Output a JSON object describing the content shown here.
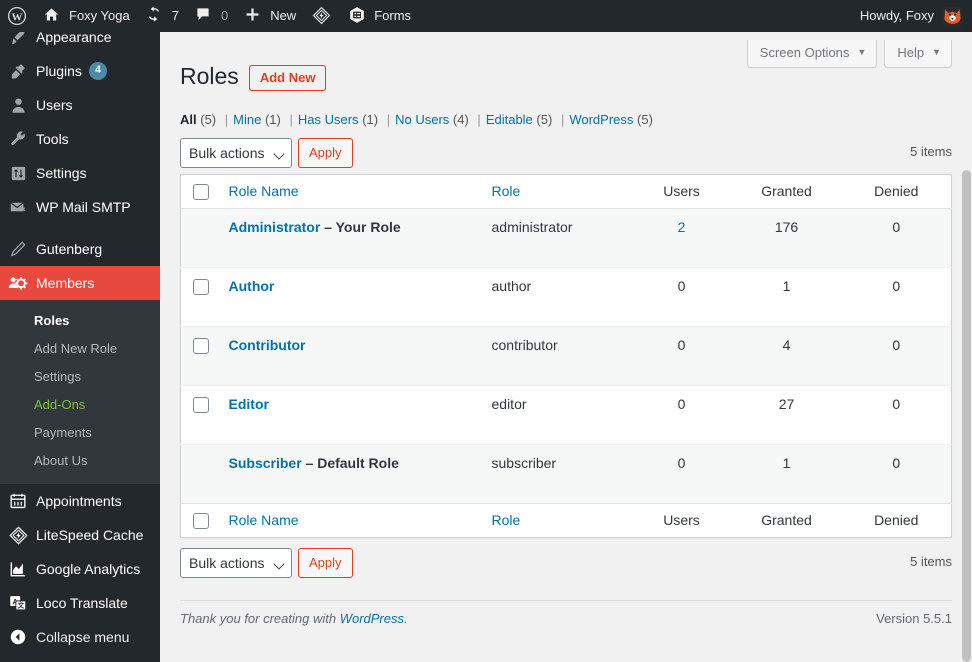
{
  "adminbar": {
    "logo_icon": "wordpress-logo-icon",
    "site": {
      "icon": "home-icon",
      "label": "Foxy Yoga"
    },
    "updates": {
      "icon": "updates-icon",
      "count": "7"
    },
    "comments": {
      "icon": "comment-bubble-icon",
      "count": "0"
    },
    "new": {
      "icon": "plus-icon",
      "label": "New"
    },
    "litespeed": {
      "icon": "litespeed-diamond-icon"
    },
    "forms": {
      "icon": "forms-icon",
      "label": "Forms"
    },
    "howdy": "Howdy, Foxy",
    "avatar_icon": "fox-avatar-icon"
  },
  "sidebar": {
    "items": [
      {
        "label": "Appearance",
        "icon": "appearance-brush-icon",
        "state": "partial"
      },
      {
        "label": "Plugins",
        "icon": "plugins-plug-icon",
        "badge": "4"
      },
      {
        "label": "Users",
        "icon": "users-person-icon"
      },
      {
        "label": "Tools",
        "icon": "tools-wrench-icon"
      },
      {
        "label": "Settings",
        "icon": "settings-sliders-icon"
      },
      {
        "label": "WP Mail SMTP",
        "icon": "email-icon"
      },
      {
        "label": "Gutenberg",
        "icon": "pencil-icon"
      },
      {
        "label": "Members",
        "icon": "members-group-icon",
        "state": "current"
      }
    ],
    "submenu": [
      {
        "label": "Roles",
        "state": "current"
      },
      {
        "label": "Add New Role"
      },
      {
        "label": "Settings"
      },
      {
        "label": "Add-Ons",
        "state": "highlight"
      },
      {
        "label": "Payments"
      },
      {
        "label": "About Us"
      }
    ],
    "lower_items": [
      {
        "label": "Appointments",
        "icon": "calendar-icon"
      },
      {
        "label": "LiteSpeed Cache",
        "icon": "litespeed-diamond-icon"
      },
      {
        "label": "Google Analytics",
        "icon": "analytics-chart-icon"
      },
      {
        "label": "Loco Translate",
        "icon": "translate-icon"
      }
    ],
    "collapse": {
      "label": "Collapse menu",
      "icon": "collapse-arrow-icon"
    }
  },
  "screen_meta": {
    "screen_options": "Screen Options",
    "help": "Help",
    "caret": "▼"
  },
  "page": {
    "title": "Roles",
    "add_new": "Add New"
  },
  "filters": [
    {
      "label": "All",
      "count": "(5)",
      "current": true
    },
    {
      "label": "Mine",
      "count": "(1)"
    },
    {
      "label": "Has Users",
      "count": "(1)"
    },
    {
      "label": "No Users",
      "count": "(4)"
    },
    {
      "label": "Editable",
      "count": "(5)"
    },
    {
      "label": "WordPress",
      "count": "(5)"
    }
  ],
  "tablenav": {
    "bulk_actions": "Bulk actions",
    "apply": "Apply",
    "items_count": "5 items"
  },
  "table": {
    "columns": {
      "name": "Role Name",
      "role": "Role",
      "users": "Users",
      "granted": "Granted",
      "denied": "Denied"
    },
    "rows": [
      {
        "name": "Administrator",
        "note": "– Your Role",
        "role": "administrator",
        "users": "2",
        "users_link": true,
        "granted": "176",
        "denied": "0",
        "checkbox": false,
        "alt": true
      },
      {
        "name": "Author",
        "note": "",
        "role": "author",
        "users": "0",
        "users_link": false,
        "granted": "1",
        "denied": "0",
        "checkbox": true,
        "alt": false
      },
      {
        "name": "Contributor",
        "note": "",
        "role": "contributor",
        "users": "0",
        "users_link": false,
        "granted": "4",
        "denied": "0",
        "checkbox": true,
        "alt": true
      },
      {
        "name": "Editor",
        "note": "",
        "role": "editor",
        "users": "0",
        "users_link": false,
        "granted": "27",
        "denied": "0",
        "checkbox": true,
        "alt": false
      },
      {
        "name": "Subscriber",
        "note": "– Default Role",
        "role": "subscriber",
        "users": "0",
        "users_link": false,
        "granted": "1",
        "denied": "0",
        "checkbox": false,
        "alt": true
      }
    ]
  },
  "footer": {
    "thankyou_prefix": "Thank you for creating with ",
    "thankyou_link": "WordPress",
    "thankyou_suffix": ".",
    "version": "Version 5.5.1"
  },
  "colors": {
    "admin_bar_bg": "#23282d",
    "menu_bg": "#23282d",
    "submenu_bg": "#32373c",
    "current_red": "#e8493f",
    "accent_red": "#e2401c",
    "link_blue": "#0073aa",
    "addon_green": "#7ac143",
    "badge_blue": "#4b8ba5",
    "page_bg": "#f1f1f1"
  }
}
